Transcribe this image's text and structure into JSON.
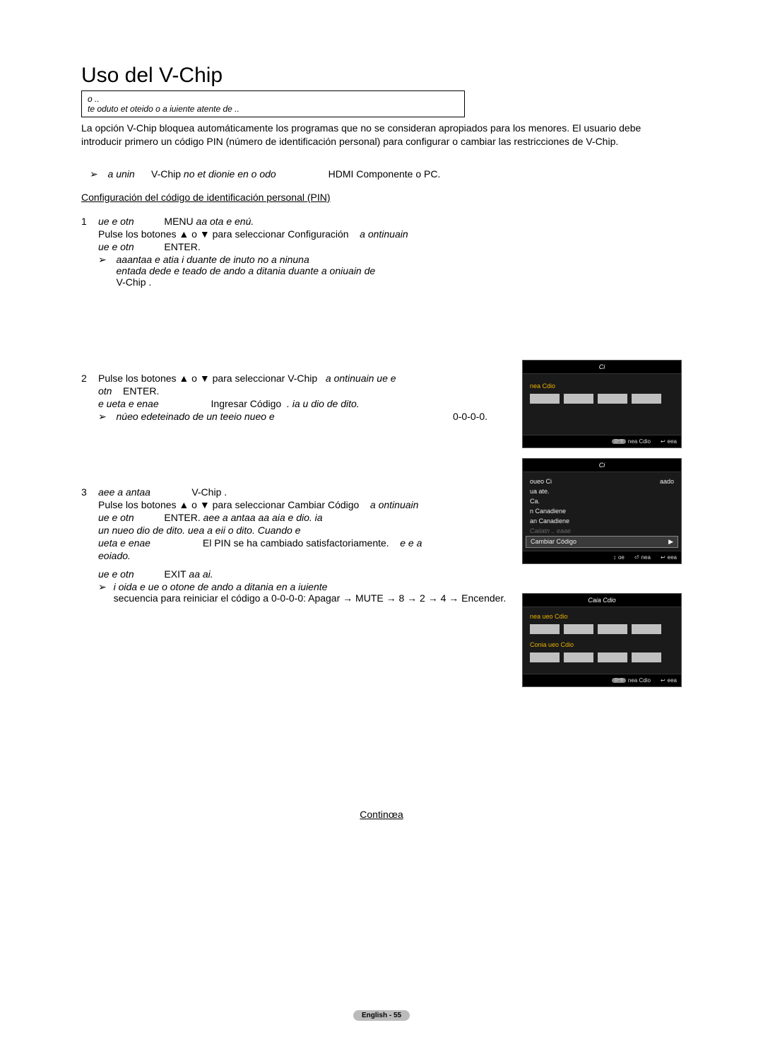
{
  "title": "Uso del V-Chip",
  "notice": {
    "line1": "o ..",
    "line2": "te oduto et oteido o a iuiente atente de .."
  },
  "intro": "La opción V-Chip bloquea automáticamente los programas que no se consideran apropiados para los menores. El usuario debe introducir primero un código PIN (número de identificación personal) para configurar o cambiar las restricciones de V-Chip.",
  "modes": {
    "lead_i": "a unin",
    "vchip": "V-Chip",
    "mid_i": " no et dionie en o odo",
    "right": "HDMI  Componente  o PC."
  },
  "subhead": "Configuración del código de identificación personal (PIN)",
  "step1": {
    "num": "1",
    "l1a": "ue e otn",
    "l1b": "MENU",
    "l1c": " aa ota e enú.",
    "l2": "Pulse los botones ▲ o ▼ para seleccionar Configuración",
    "l2b": "a ontinuain",
    "l3a": "ue e otn",
    "l3b": "ENTER.",
    "note1": "aaantaa e atia i duante  de  inuto no a ninuna",
    "note2": "entada dede e teado de ando a ditania duante a oniuain de",
    "note3": "V-Chip ."
  },
  "step2": {
    "num": "2",
    "l1": "Pulse los botones ▲ o ▼ para seleccionar V-Chip",
    "l1b": "a ontinuain ue e",
    "l2a": "otn",
    "l2b": "ENTER.",
    "l3a": "e ueta e enae",
    "l3b": "Ingresar Código",
    "l3c": ". ia u dio  de  dito.",
    "note": "núeo  edeteinado de un teeio nueo e",
    "code": "0-0-0-0."
  },
  "step3": {
    "num": "3",
    "l1a": "aee a antaa",
    "l1b": "V-Chip .",
    "l2": "Pulse los botones ▲ o ▼ para seleccionar Cambiar Código",
    "l2b": "a ontinuain",
    "l3a": "ue e otn",
    "l3b": "ENTER.",
    "l3c": " aee a antaa aa aia e dio. ia",
    "l4": "un nueo dio  de  dito. uea a eii o  dito. Cuando e",
    "l5a": "ueta e enae",
    "l5b": "El PIN se ha cambiado satisfactoriamente.",
    "l5c": "e  e a",
    "l6": "eoiado.",
    "l7a": "ue e otn",
    "l7b": "EXIT",
    "l7c": " aa ai.",
    "note1": "i oida e  ue o otone de ando a ditania en a iuiente",
    "note2": "secuencia para reiniciar el código a 0-0-0-0: Apagar → MUTE → 8 → 2 → 4 → Encender."
  },
  "continue": "Continœa",
  "pagenum": "English - 55",
  "osd2": {
    "title": "Ci",
    "label": "nea Cdio",
    "foot_a": "nea Cdio",
    "foot_b": "eea"
  },
  "osd3": {
    "title": "Ci",
    "rows": [
      {
        "l": "oueo Ci",
        "r": "aado"
      },
      {
        "l": "ua ate.",
        "r": ""
      },
      {
        "l": "Ca.",
        "r": ""
      },
      {
        "l": "n Canadiene",
        "r": ""
      },
      {
        "l": "an Canadiene",
        "r": ""
      }
    ],
    "muted": "Caiiatn .. eaae",
    "hl": "Cambiar Código",
    "foot_move": "oe",
    "foot_enter": "nea",
    "foot_ret": "eea"
  },
  "osd4": {
    "title": "Caia Cdio",
    "label1": "nea ueo Cdio",
    "label2": "Conia ueo Cdio",
    "foot_a": "nea Cdio",
    "foot_b": "eea"
  }
}
